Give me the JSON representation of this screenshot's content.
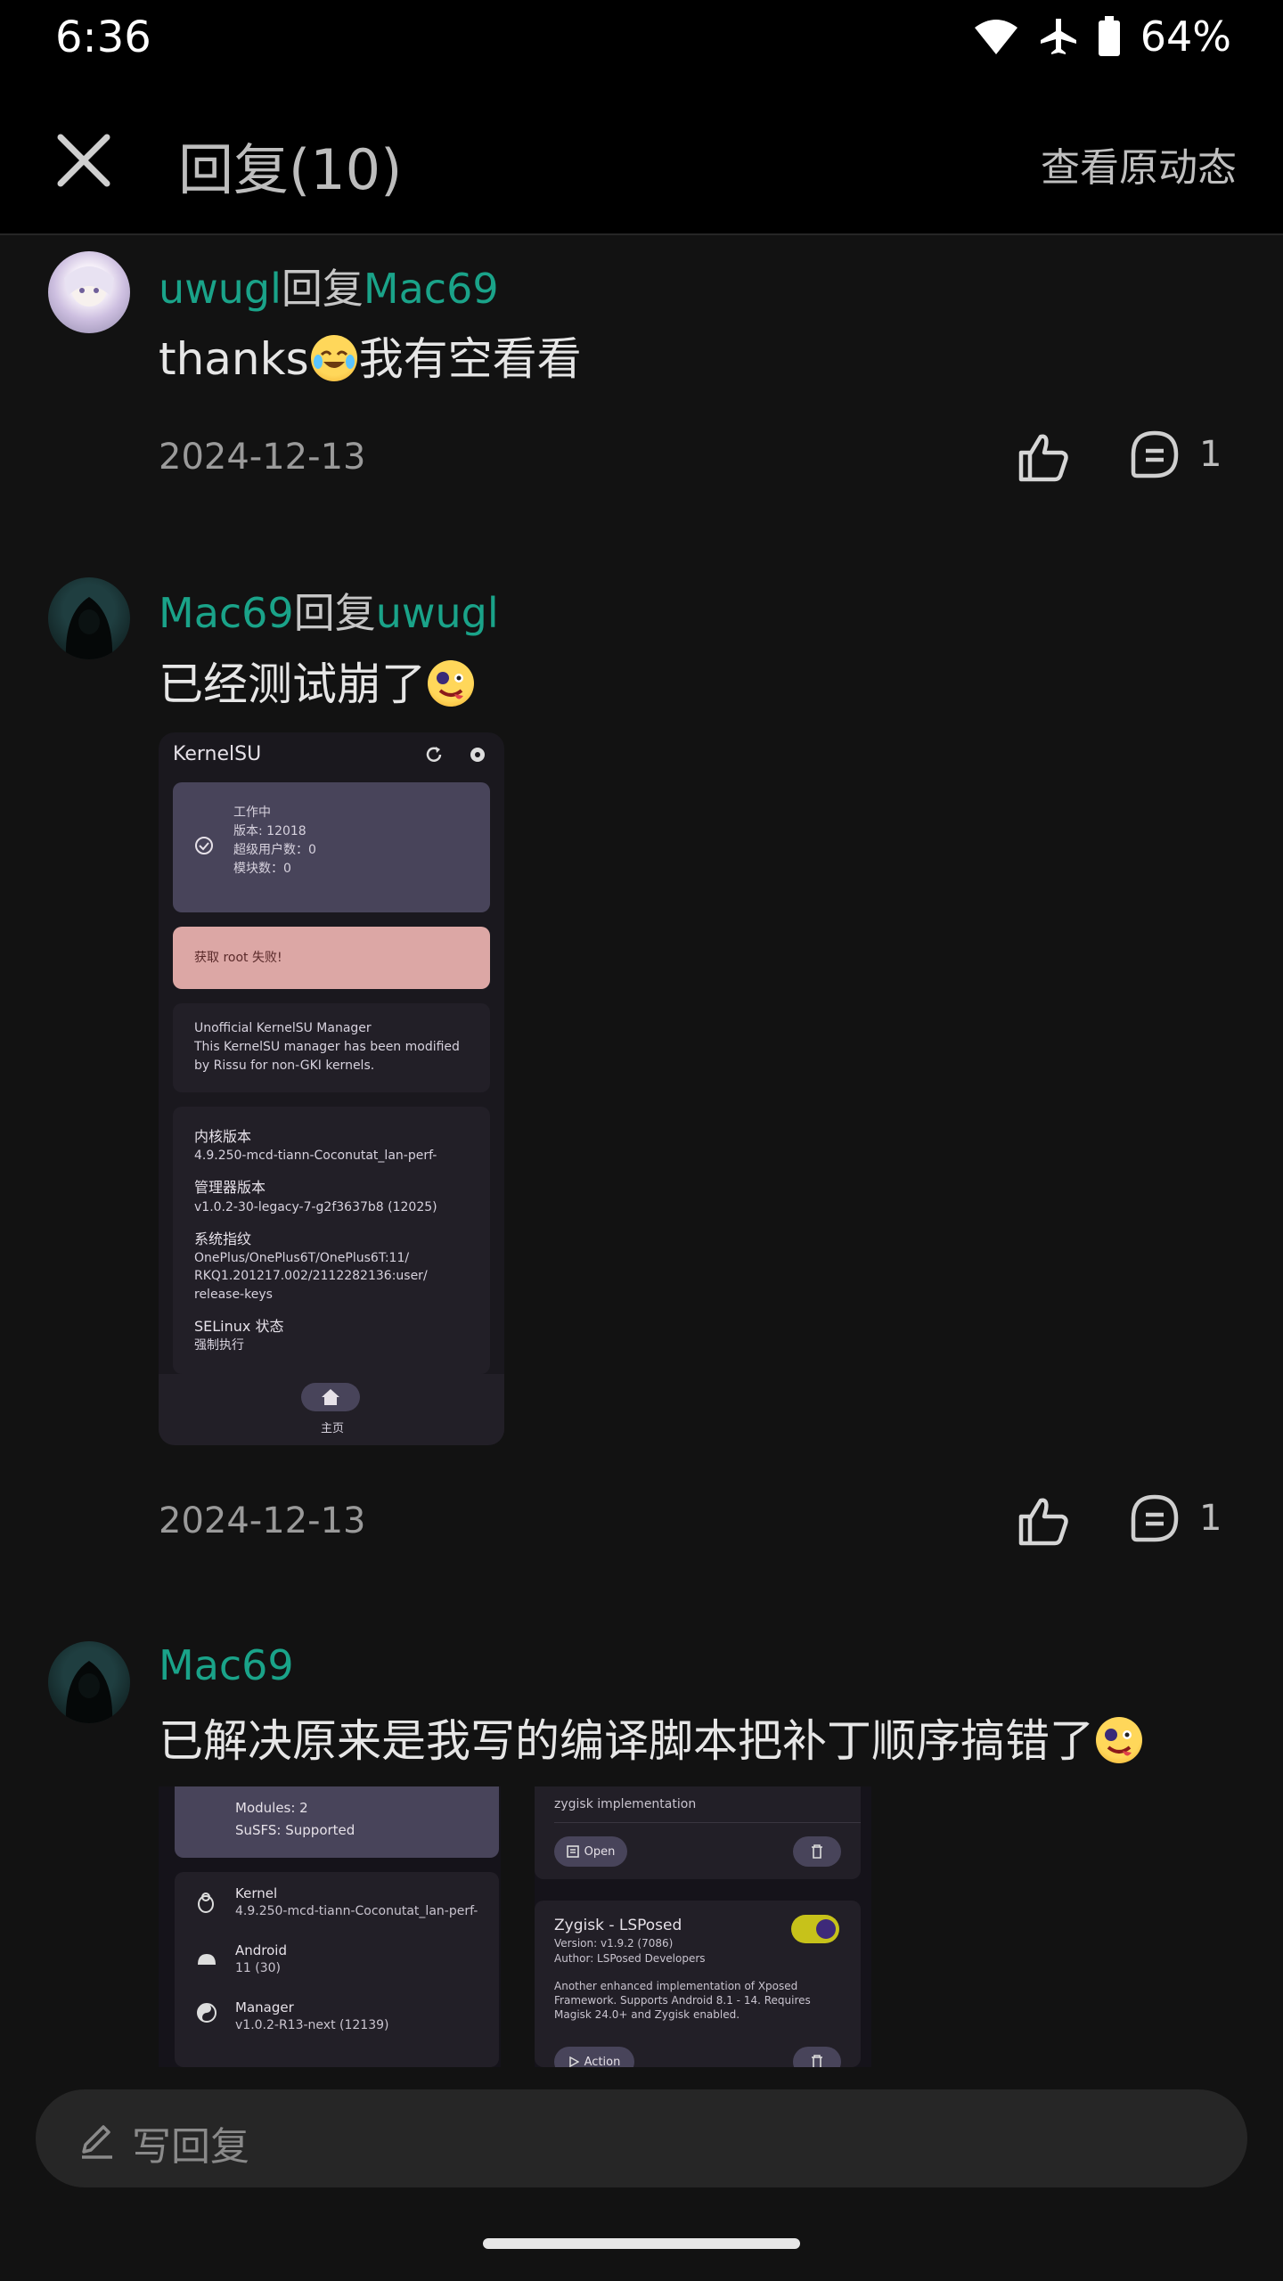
{
  "status": {
    "time": "6:36",
    "battery": "64%"
  },
  "header": {
    "title": "回复(10)",
    "view_original": "查看原动态"
  },
  "comments": [
    {
      "author": "uwugl",
      "reply_word": "回复",
      "target": "Mac69",
      "text_before": "thanks",
      "text_after": "我有空看看",
      "date": "2024-12-13",
      "comment_count": "1"
    },
    {
      "author": "Mac69",
      "reply_word": "回复",
      "target": "uwugl",
      "text_before": "已经测试崩了",
      "date": "2024-12-13",
      "comment_count": "1"
    },
    {
      "author": "Mac69",
      "text_before": "已解决原来是我写的编译脚本把补丁顺序搞错了"
    }
  ],
  "shot1": {
    "app_title": "KernelSU",
    "status_title": "工作中",
    "version": "版本: 12018",
    "superusers": "超级用户数：0",
    "modules": "模块数：0",
    "error": "获取 root 失败!",
    "unofficial_title": "Unofficial KernelSU Manager",
    "unofficial_desc": "This KernelSU manager has been modified by Rissu for non-GKI kernels.",
    "kernel_label": "内核版本",
    "kernel_value": "4.9.250-mcd-tiann-Coconutat_lan-perf-",
    "manager_label": "管理器版本",
    "manager_value": "v1.0.2-30-legacy-7-g2f3637b8 (12025)",
    "fingerprint_label": "系统指纹",
    "fingerprint_value": "OnePlus/OnePlus6T/OnePlus6T:11/ RKQ1.201217.002/2112282136:user/ release-keys",
    "selinux_label": "SELinux 状态",
    "selinux_value": "强制执行",
    "nav_home": "主页"
  },
  "shot2": {
    "modules_line": "Modules: 2",
    "susfs": "SuSFS: Supported",
    "kernel_label": "Kernel",
    "kernel_value": "4.9.250-mcd-tiann-Coconutat_lan-perf-",
    "android_label": "Android",
    "android_value": "11 (30)",
    "manager_label": "Manager",
    "manager_value": "v1.0.2-R13-next (12139)",
    "zygisk_impl": "zygisk implementation",
    "open_label": "Open",
    "module_title": "Zygisk - LSPosed",
    "module_version": "Version: v1.9.2 (7086)",
    "module_author": "Author: LSPosed Developers",
    "module_desc": "Another enhanced implementation of Xposed Framework. Supports Android 8.1 - 14. Requires Magisk 24.0+ and Zygisk enabled.",
    "action_label": "Action"
  },
  "composer": {
    "placeholder": "写回复"
  }
}
